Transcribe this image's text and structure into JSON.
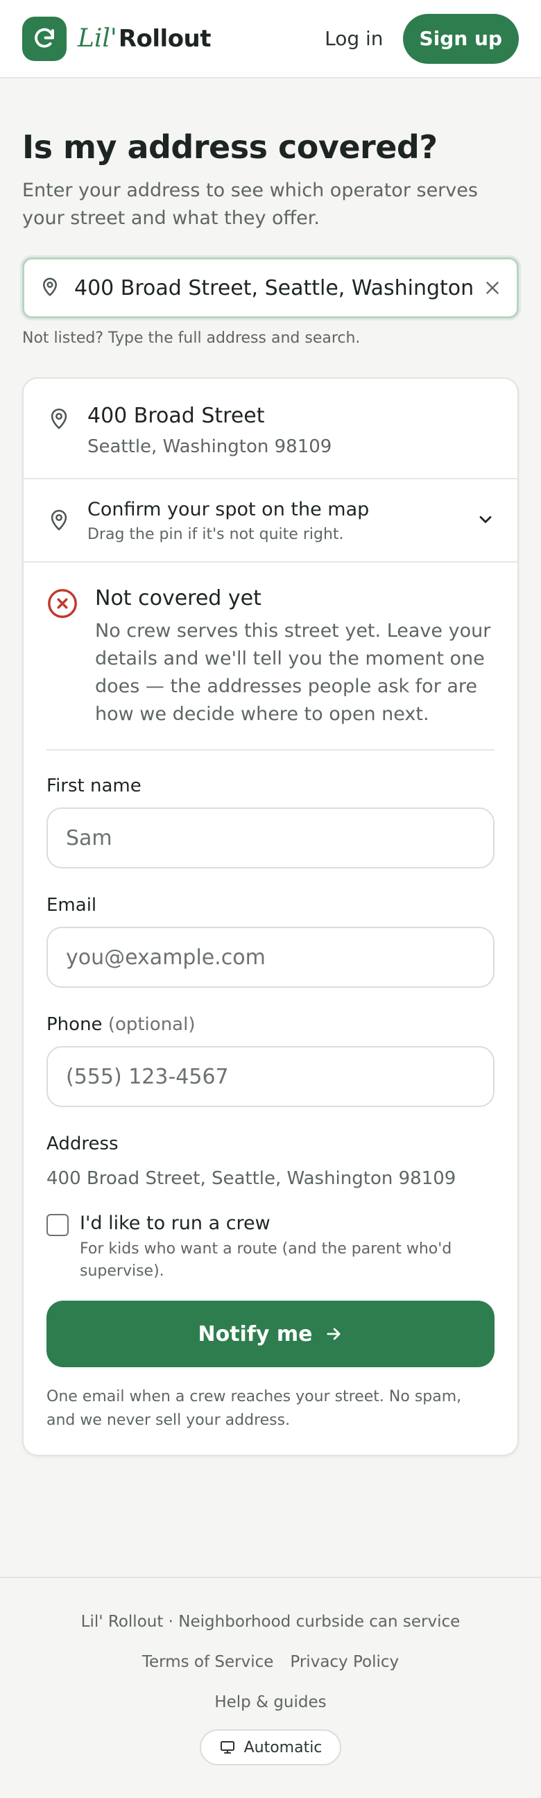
{
  "header": {
    "brand_prefix": "Lil'",
    "brand_name": "Rollout",
    "login_label": "Log in",
    "signup_label": "Sign up"
  },
  "main": {
    "title": "Is my address covered?",
    "subtitle": "Enter your address to see which operator serves your street and what they offer.",
    "search": {
      "value": "400 Broad Street, Seattle, Washington 98109",
      "hint": "Not listed? Type the full address and search."
    }
  },
  "result": {
    "address_line1": "400 Broad Street",
    "address_line2": "Seattle, Washington 98109",
    "map_title": "Confirm your spot on the map",
    "map_subtitle": "Drag the pin if it's not quite right.",
    "status_title": "Not covered yet",
    "status_body": "No crew serves this street yet. Leave your details and we'll tell you the moment one does — the addresses people ask for are how we decide where to open next."
  },
  "form": {
    "first_name_label": "First name",
    "first_name_placeholder": "Sam",
    "email_label": "Email",
    "email_placeholder": "you@example.com",
    "phone_label": "Phone",
    "phone_optional": "(optional)",
    "phone_placeholder": "(555) 123-4567",
    "address_label": "Address",
    "address_value": "400 Broad Street, Seattle, Washington 98109",
    "crew_label": "I'd like to run a crew",
    "crew_help": "For kids who want a route (and the parent who'd supervise).",
    "submit_label": "Notify me",
    "fine_print": "One email when a crew reaches your street. No spam, and we never sell your address."
  },
  "footer": {
    "brand_line": "Lil' Rollout · Neighborhood curbside can service",
    "terms_label": "Terms of Service",
    "privacy_label": "Privacy Policy",
    "help_label": "Help & guides",
    "theme_label": "Automatic"
  },
  "colors": {
    "brand_green": "#2e7d4f",
    "error_red": "#c0392b",
    "background": "#f5f5f3"
  },
  "icons": {
    "logo": "refresh-icon",
    "pin": "map-pin-icon",
    "clear": "close-icon",
    "expand": "chevron-down-icon",
    "status": "error-circle-x-icon",
    "submit": "arrow-right-icon",
    "theme": "monitor-icon"
  }
}
